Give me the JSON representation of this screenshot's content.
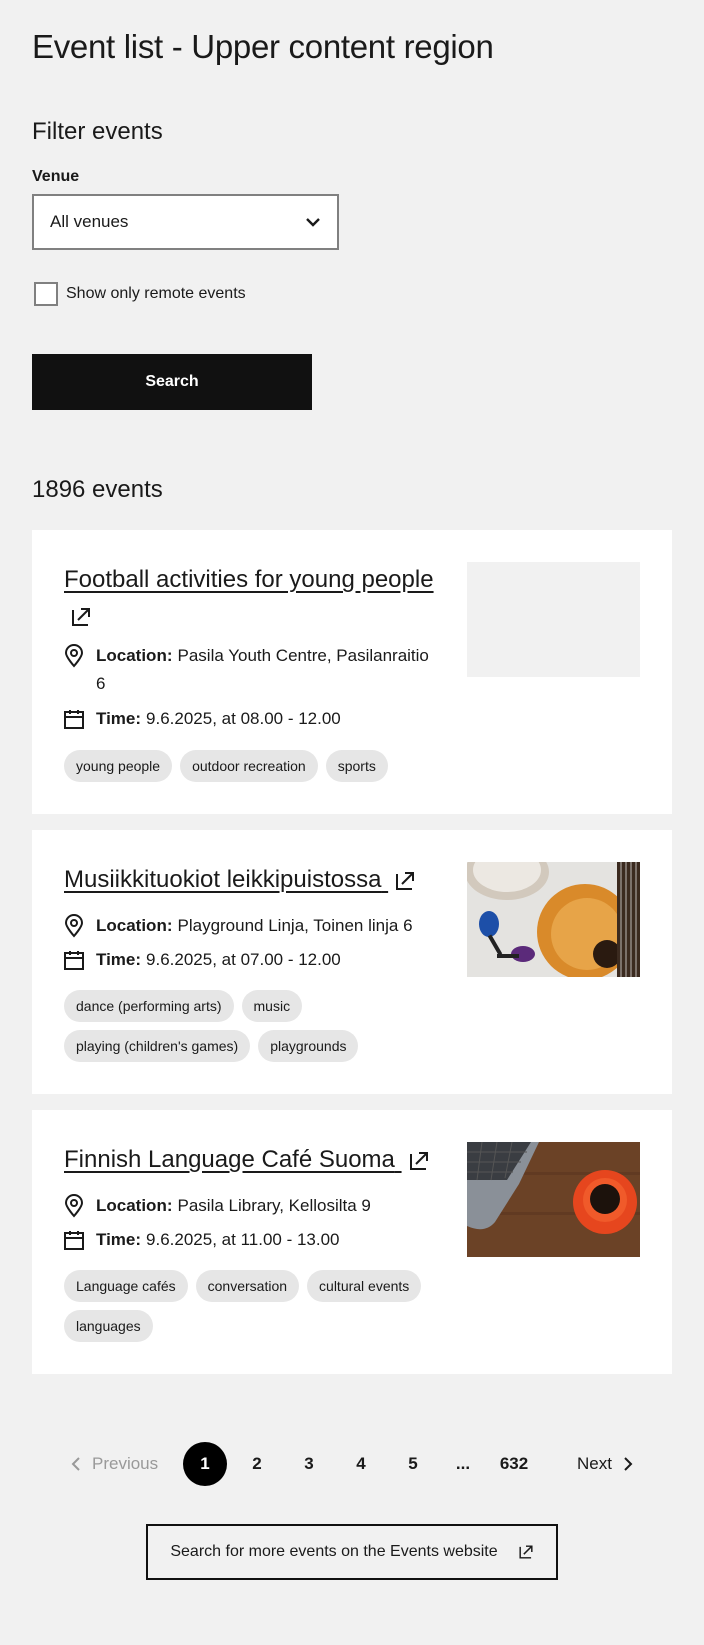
{
  "page": {
    "title": "Event list - Upper content region"
  },
  "filters": {
    "title": "Filter events",
    "venue_label": "Venue",
    "venue_value": "All venues",
    "remote_label": "Show only remote events",
    "remote_checked": false,
    "search_label": "Search"
  },
  "results": {
    "count_text": "1896 events"
  },
  "events": [
    {
      "title": "Football activities for young people",
      "location_label": "Location:",
      "location": "Pasila Youth Centre, Pasilanraitio 6",
      "time_label": "Time:",
      "time": "9.6.2025, at 08.00 - 12.00",
      "tags": [
        "young people",
        "outdoor recreation",
        "sports"
      ],
      "image": "placeholder"
    },
    {
      "title": "Musiikkituokiot leikkipuistossa",
      "location_label": "Location:",
      "location": "Playground Linja, Toinen linja 6",
      "time_label": "Time:",
      "time": "9.6.2025, at 07.00 - 12.00",
      "tags": [
        "dance (performing arts)",
        "music",
        "playing (children's games)",
        "playgrounds"
      ],
      "image": "instruments-photo"
    },
    {
      "title": "Finnish Language Café Suoma",
      "location_label": "Location:",
      "location": "Pasila Library, Kellosilta 9",
      "time_label": "Time:",
      "time": "9.6.2025, at 11.00 - 13.00",
      "tags": [
        "Language cafés",
        "conversation",
        "cultural events",
        "languages"
      ],
      "image": "coffee-laptop-photo"
    }
  ],
  "pagination": {
    "previous": "Previous",
    "pages": [
      "1",
      "2",
      "3",
      "4",
      "5"
    ],
    "ellipsis": "...",
    "last": "632",
    "next": "Next",
    "current": "1"
  },
  "more_link": {
    "label": "Search for more events on the Events website"
  },
  "colors": {
    "background": "#f1f1f1",
    "card": "#ffffff",
    "button": "#111111",
    "tag": "#e6e6e6"
  }
}
